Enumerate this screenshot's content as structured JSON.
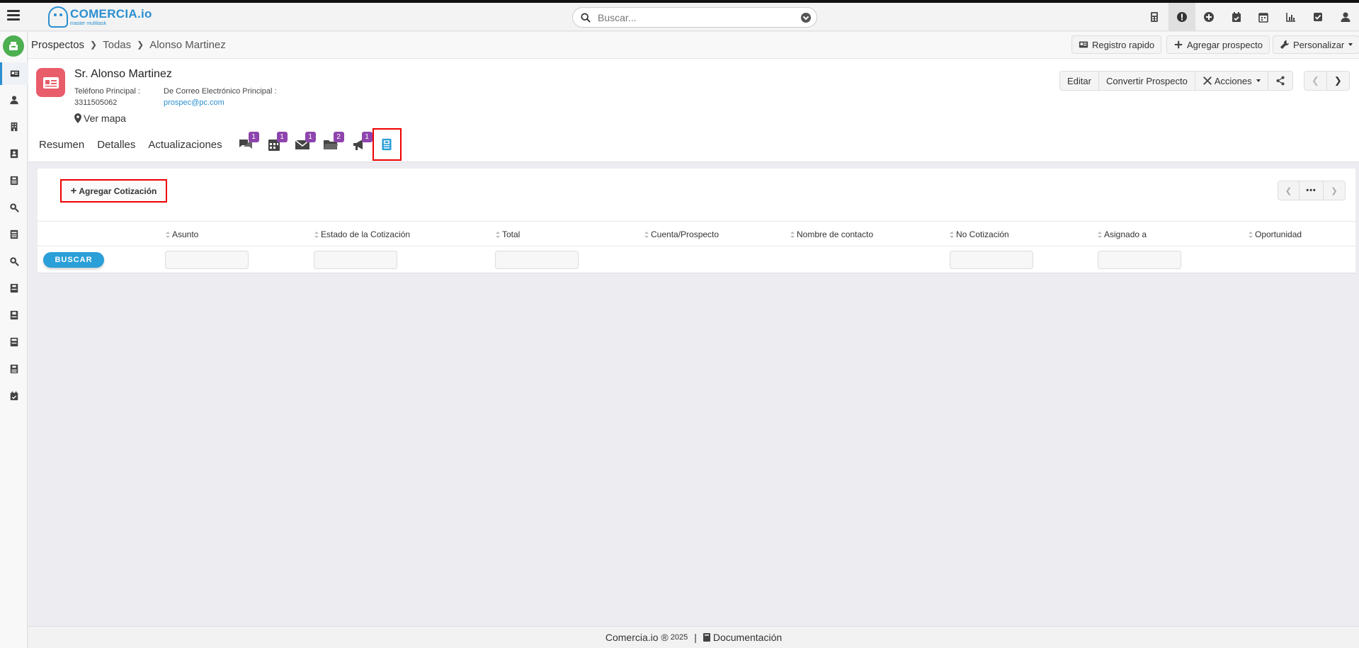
{
  "app": {
    "brand_name": "COMERCIA.io",
    "brand_sub": "master multitask"
  },
  "search": {
    "placeholder": "Buscar..."
  },
  "top_icons": [
    "calculator-icon",
    "alert-icon",
    "plus-circle-icon",
    "calendar-check-icon",
    "calendar-icon",
    "chart-icon",
    "checkbox-icon",
    "user-icon"
  ],
  "breadcrumb": {
    "root": "Prospectos",
    "middle": "Todas",
    "current": "Alonso Martinez"
  },
  "toolbar": {
    "quick_register": "Registro rapido",
    "add_prospect": "Agregar prospecto",
    "customize": "Personalizar"
  },
  "record": {
    "name": "Sr. Alonso Martinez",
    "phone_label": "Teléfono Principal :",
    "phone_value": "3311505062",
    "email_label": "De Correo Electrónico Principal :",
    "email_value": "prospec@pc.com",
    "map_link": "Ver mapa"
  },
  "actions": {
    "edit": "Editar",
    "convert": "Convertir Prospecto",
    "actions": "Acciones"
  },
  "tabs": {
    "summary": "Resumen",
    "details": "Detalles",
    "updates": "Actualizaciones",
    "related": [
      {
        "icon": "comments-icon",
        "count": "1"
      },
      {
        "icon": "calendar-icon",
        "count": "1"
      },
      {
        "icon": "envelope-icon",
        "count": "1"
      },
      {
        "icon": "folder-icon",
        "count": "2"
      },
      {
        "icon": "megaphone-icon",
        "count": "1"
      },
      {
        "icon": "quote-document-icon",
        "count": ""
      }
    ]
  },
  "quotes": {
    "add_button": "Agregar Cotización",
    "search_button": "BUSCAR",
    "columns": [
      "Asunto",
      "Estado de la Cotización",
      "Total",
      "Cuenta/Prospecto",
      "Nombre de contacto",
      "No Cotización",
      "Asignado a",
      "Oportunidad"
    ]
  },
  "footer": {
    "brand": "Comercia.io ®",
    "year": "2025",
    "sep": "|",
    "docs": "Documentación"
  },
  "colors": {
    "accent": "#2a8fd0",
    "badge": "#8e44ad",
    "record_icon": "#e95d6b",
    "highlight": "#ee0000"
  }
}
